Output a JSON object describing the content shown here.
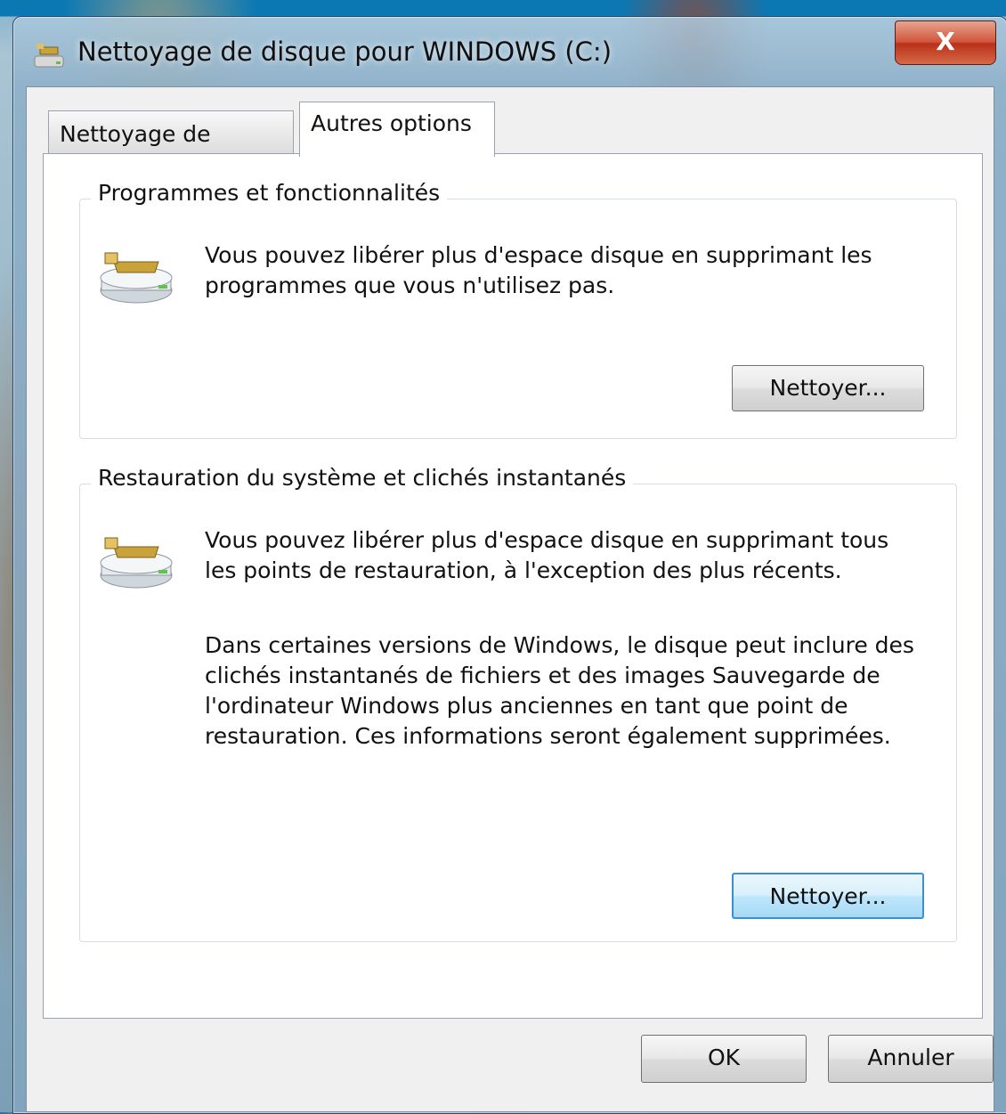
{
  "window": {
    "title": "Nettoyage de disque pour WINDOWS (C:)",
    "close_label": "X"
  },
  "tabs": [
    {
      "label": "Nettoyage de disque",
      "selected": false
    },
    {
      "label": "Autres options",
      "selected": true
    }
  ],
  "groups": [
    {
      "title": "Programmes et fonctionnalités",
      "icon": "disk-cleanup-icon",
      "description": "Vous pouvez libérer plus d'espace disque en supprimant les programmes que vous n'utilisez pas.",
      "button_label": "Nettoyer..."
    },
    {
      "title": "Restauration du système et clichés instantanés",
      "icon": "disk-cleanup-icon",
      "description": "Vous pouvez libérer plus d'espace disque en supprimant tous les points de restauration, à l'exception des plus récents.",
      "details": "Dans certaines versions de Windows, le disque peut inclure des clichés instantanés de fichiers et des images Sauvegarde de l'ordinateur Windows plus anciennes en tant que point de restauration. Ces informations seront également supprimées.",
      "button_label": "Nettoyer..."
    }
  ],
  "footer": {
    "ok_label": "OK",
    "cancel_label": "Annuler"
  }
}
